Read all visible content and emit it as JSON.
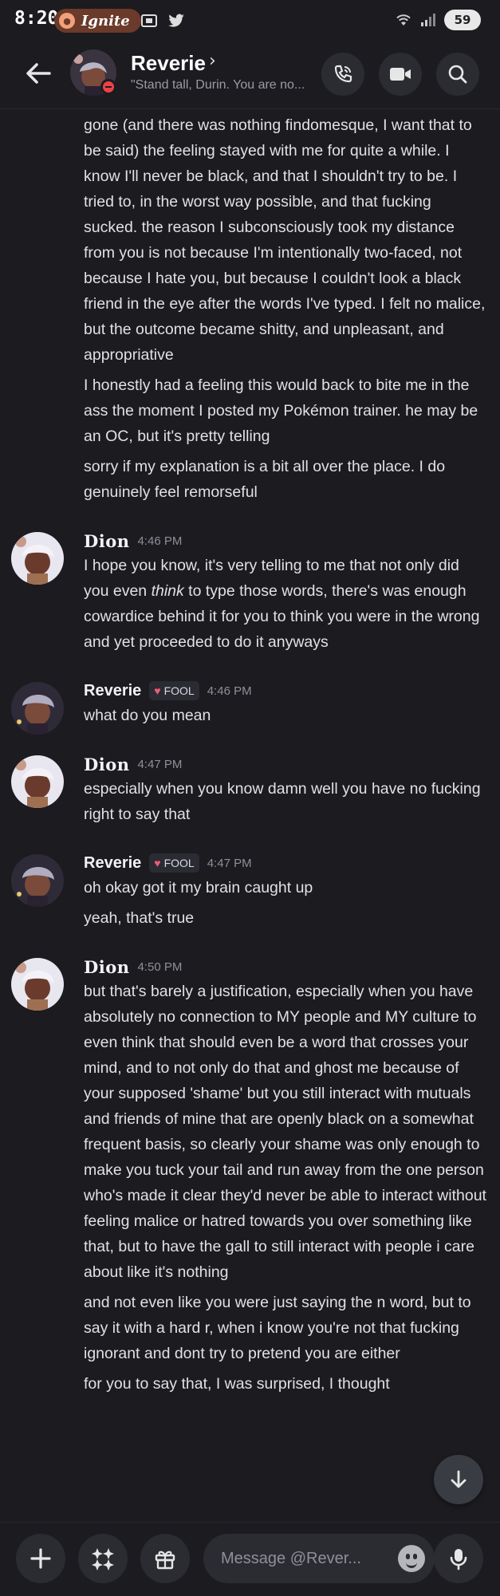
{
  "status_bar": {
    "time": "8:20",
    "app_pill": "Ignite",
    "battery": "59",
    "signal_label": "6"
  },
  "header": {
    "name": "Reverie",
    "status": "\"Stand tall, Durin. You are no..."
  },
  "messages": {
    "top_block": [
      "gone (and there was nothing findomesque, I want that to be said) the feeling stayed with me for quite a while. I know I'll never be black, and that I shouldn't try to be. I tried to, in the worst way possible, and that fucking sucked. the reason I subconsciously took my distance from you is not because I'm intentionally two-faced, not because I hate you, but because I couldn't look a black friend in the eye after the words I've typed. I felt no malice, but the outcome became shitty, and unpleasant, and appropriative",
      "I honestly had a feeling this would back to bite me in the ass the moment I posted my Pokémon trainer. he may be an OC, but it's pretty telling",
      "sorry if my explanation is a bit all over the place. I do genuinely feel remorseful"
    ],
    "g1": {
      "user": "Dion",
      "time": "4:46 PM",
      "text_pre": "I hope you know, it's very telling to me that not only did you even ",
      "text_em": "think",
      "text_post": " to type those words, there's was enough cowardice behind it for you to think you were in the wrong and yet proceeded to do it anyways"
    },
    "g2": {
      "user": "Reverie",
      "tag": "FOOL",
      "time": "4:46 PM",
      "lines": [
        "what do you mean"
      ]
    },
    "g3": {
      "user": "Dion",
      "time": "4:47 PM",
      "lines": [
        "especially when you know damn well you have no fucking right to say that"
      ]
    },
    "g4": {
      "user": "Reverie",
      "tag": "FOOL",
      "time": "4:47 PM",
      "lines": [
        "oh okay got it my brain caught up",
        "yeah, that's true"
      ]
    },
    "g5": {
      "user": "Dion",
      "time": "4:50 PM",
      "lines": [
        "but that's barely a justification, especially when you have absolutely no connection to MY people and MY culture to even think that should even be a word that crosses your mind, and to not only do that and ghost me because of your supposed 'shame' but you still interact with mutuals and friends of mine that are openly black on a somewhat frequent basis, so clearly your shame was only enough to make you tuck your tail and run away from the one person who's made it clear they'd never be able to interact without feeling malice or hatred towards you over something like that, but to have the gall to still interact with people i care about like it's nothing",
        "and not even like you were just saying the n word, but to say it with a hard r, when i know you're not that fucking ignorant and dont try to pretend you are either",
        "for you to say that, I was surprised, I thought"
      ]
    }
  },
  "composer": {
    "placeholder": "Message @Rever..."
  },
  "icons": [
    "back-arrow-icon",
    "phone-icon",
    "video-icon",
    "search-icon",
    "plus-icon",
    "apps-icon",
    "gift-icon",
    "emoji-icon",
    "microphone-icon",
    "arrow-down-icon"
  ]
}
